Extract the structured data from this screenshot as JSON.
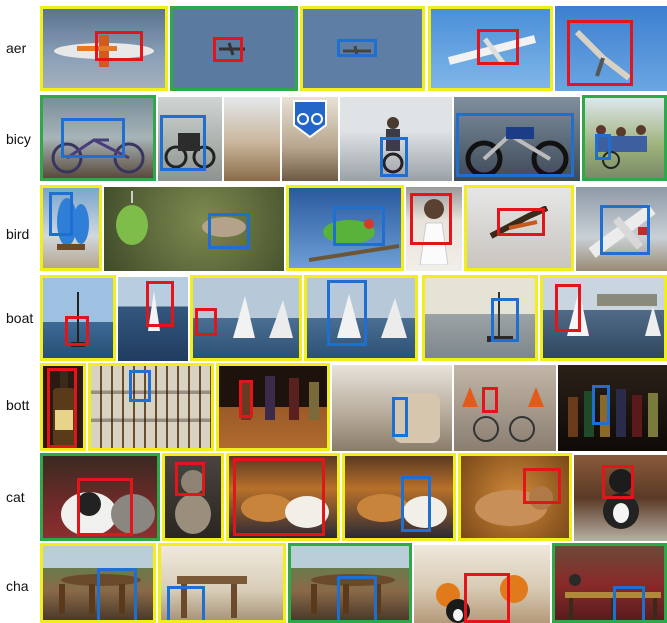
{
  "row_labels": [
    "aer",
    "bicy",
    "bird",
    "boat",
    "bott",
    "cat",
    "cha"
  ],
  "legend": {
    "frame_colors": {
      "yellow": "#f2ee1c",
      "green": "#2fa84a"
    },
    "box_colors": {
      "red": "#e3151b",
      "blue": "#1f6fd0"
    }
  },
  "rows": [
    {
      "label": "aer",
      "images": [
        {
          "subject": "airplane",
          "frame": "yellow",
          "box": "red"
        },
        {
          "subject": "airplane",
          "frame": "green",
          "box": "red"
        },
        {
          "subject": "airplane",
          "frame": "yellow",
          "box": "blue"
        },
        {
          "subject": "airplane",
          "frame": "yellow",
          "box": "red"
        },
        {
          "subject": "bird",
          "frame": "none",
          "box": "red"
        }
      ]
    },
    {
      "label": "bicy",
      "images": [
        {
          "subject": "bicycle",
          "frame": "green",
          "box": "blue"
        },
        {
          "subject": "bicycle",
          "frame": "none",
          "box": "blue"
        },
        {
          "subject": "street",
          "frame": "none",
          "box": "none"
        },
        {
          "subject": "sign",
          "frame": "none",
          "box": "none"
        },
        {
          "subject": "motorcycle",
          "frame": "none",
          "box": "blue"
        },
        {
          "subject": "motorcycle",
          "frame": "none",
          "box": "blue"
        },
        {
          "subject": "bicycle",
          "frame": "green",
          "box": "blue"
        }
      ]
    },
    {
      "label": "bird",
      "images": [
        {
          "subject": "bird",
          "frame": "yellow",
          "box": "blue"
        },
        {
          "subject": "bird",
          "frame": "none",
          "box": "blue"
        },
        {
          "subject": "bird",
          "frame": "yellow",
          "box": "blue"
        },
        {
          "subject": "person",
          "frame": "none",
          "box": "red"
        },
        {
          "subject": "bird",
          "frame": "yellow",
          "box": "red"
        },
        {
          "subject": "airplane",
          "frame": "none",
          "box": "blue"
        }
      ]
    },
    {
      "label": "boat",
      "images": [
        {
          "subject": "boat",
          "frame": "yellow",
          "box": "red"
        },
        {
          "subject": "boat",
          "frame": "none",
          "box": "red"
        },
        {
          "subject": "boat",
          "frame": "yellow",
          "box": "red"
        },
        {
          "subject": "boat",
          "frame": "yellow",
          "box": "blue"
        },
        {
          "subject": "boat",
          "frame": "yellow",
          "box": "blue"
        },
        {
          "subject": "boat",
          "frame": "yellow",
          "box": "red"
        }
      ]
    },
    {
      "label": "bott",
      "images": [
        {
          "subject": "bottle",
          "frame": "yellow",
          "box": "red"
        },
        {
          "subject": "bottle",
          "frame": "yellow",
          "box": "blue"
        },
        {
          "subject": "bottle",
          "frame": "yellow",
          "box": "red"
        },
        {
          "subject": "room",
          "frame": "none",
          "box": "blue"
        },
        {
          "subject": "bicycle",
          "frame": "none",
          "box": "red"
        },
        {
          "subject": "bottle",
          "frame": "none",
          "box": "blue"
        }
      ]
    },
    {
      "label": "cat",
      "images": [
        {
          "subject": "cat",
          "frame": "green",
          "box": "red"
        },
        {
          "subject": "cat",
          "frame": "yellow",
          "box": "red"
        },
        {
          "subject": "cat",
          "frame": "yellow",
          "box": "red"
        },
        {
          "subject": "cat",
          "frame": "yellow",
          "box": "blue"
        },
        {
          "subject": "cat",
          "frame": "yellow",
          "box": "red"
        },
        {
          "subject": "cat",
          "frame": "none",
          "box": "red"
        }
      ]
    },
    {
      "label": "cha",
      "images": [
        {
          "subject": "chair",
          "frame": "yellow",
          "box": "blue"
        },
        {
          "subject": "chair",
          "frame": "yellow",
          "box": "blue"
        },
        {
          "subject": "chair",
          "frame": "green",
          "box": "blue"
        },
        {
          "subject": "cat",
          "frame": "none",
          "box": "red"
        },
        {
          "subject": "chair",
          "frame": "green",
          "box": "blue"
        }
      ]
    }
  ]
}
